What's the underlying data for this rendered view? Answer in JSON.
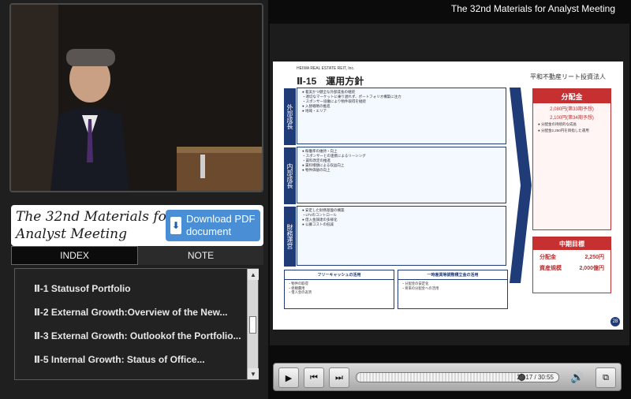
{
  "app": {
    "title": "The 32nd Materials for Analyst Meeting"
  },
  "banner": {
    "title": "The 32nd Materials for Analyst Meeting",
    "download_label": "Download PDF document"
  },
  "tabs": [
    {
      "label": "INDEX",
      "active": true
    },
    {
      "label": "NOTE",
      "active": false
    }
  ],
  "index": {
    "items": [
      {
        "label": "Ⅱ-1 Statusof Portfolio"
      },
      {
        "label": "Ⅱ-2 External Growth:Overview of the New..."
      },
      {
        "label": "Ⅱ-3 External Growth: Outlookof the Portfolio..."
      },
      {
        "label": "Ⅱ-5 Internal Growth: Status of Office..."
      }
    ]
  },
  "slide": {
    "company_small": "HEIWA REAL ESTATE REIT, Inc.",
    "title": "Ⅱ-15　運用方針",
    "logo_text": "平和不動産リート投資法人",
    "sections": [
      {
        "label": "外部成長",
        "lines": [
          "● 着実かつ健全な外部成長の継続",
          "・適切なマーケットに乗り遅れず、ポートフォリオ構築に注力",
          "・スポンサー協働により物件取得を継続",
          "● 入替戦略の推進",
          "● 地域・エリア"
        ]
      },
      {
        "label": "内部成長",
        "lines": [
          "● 稼働率の維持・向上",
          "・スポンサーとの連携によるリーシング",
          "・賃料改定の推進",
          "● 賃料増額による収益向上",
          "● 物件価値の向上"
        ]
      },
      {
        "label": "財務運営",
        "lines": [
          "● 安定した財務基盤の構築",
          "・LTVのコントロール",
          "● 借入金調達の多様化",
          "● 公募コストの低減"
        ]
      }
    ],
    "distribution": {
      "header": "分配金",
      "values": [
        "2,080円(第33期予想)",
        "2,100円(第34期予想)"
      ],
      "notes": [
        "● 分配金の持続的な成長",
        "● 分配金2,250円を目指した運用"
      ]
    },
    "mid_target": {
      "header": "中期目標",
      "rows": [
        {
          "label": "分配金",
          "value": "2,250円"
        },
        {
          "label": "資産規模",
          "value": "2,000億円"
        }
      ]
    },
    "bottom_boxes": [
      {
        "title": "フリーキャッシュの活用",
        "lines": [
          "・物件の取得",
          "・修繕費用",
          "・借入金の返済"
        ]
      },
      {
        "title": "一時差異等調整積立金の活用",
        "lines": [
          "・分配金の安定化",
          "・将来の分配金への活用"
        ]
      }
    ],
    "page_number": "28"
  },
  "controls": {
    "play_label": "▶",
    "prev_label": "⏮",
    "next_label": "⏭",
    "fullscreen_label": "⧉",
    "time": "25:17 / 30:55",
    "progress": 0.82
  }
}
